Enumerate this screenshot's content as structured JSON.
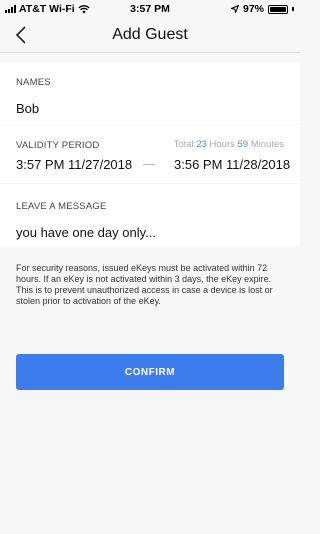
{
  "status_bar": {
    "carrier": "AT&T Wi-Fi",
    "time": "3:57 PM",
    "battery": "97%",
    "battery_level": 0.97
  },
  "nav": {
    "title": "Add Guest"
  },
  "names": {
    "label": "NAMES",
    "value": "Bob"
  },
  "validity": {
    "label": "VALIDITY PERIOD",
    "total_prefix": "Total:",
    "hours_value": "23",
    "hours_label": " Hours ",
    "minutes_value": "59",
    "minutes_label": " Minutes",
    "start": "3:57 PM 11/27/2018",
    "end": "3:56 PM 11/28/2018"
  },
  "message": {
    "label": "LEAVE A MESSAGE",
    "value": "you have one day only..."
  },
  "info": {
    "text": "For security reasons, issued eKeys must be activated within 72 hours. If an eKey is not activated within 3 days, the eKey expire. This is to prevent unauthorized access in case a device is lost or stolen prior to activation of the eKey."
  },
  "actions": {
    "confirm_label": "CONFIRM"
  },
  "colors": {
    "accent": "#3d7ded",
    "highlight": "#4a8fe0",
    "background": "#f7f7f7"
  }
}
